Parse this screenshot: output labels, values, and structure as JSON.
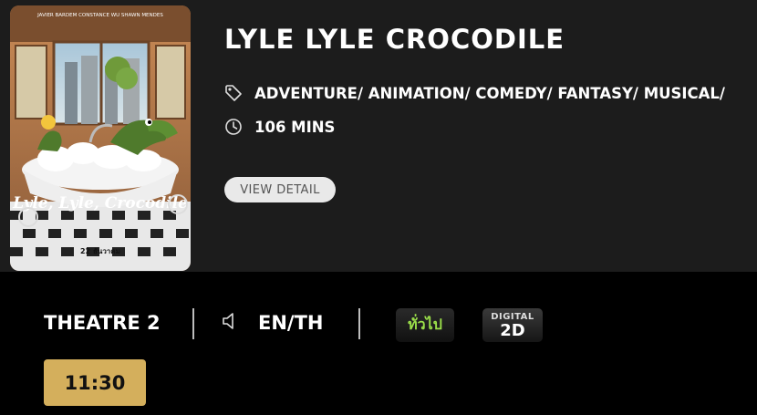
{
  "movie": {
    "title": "LYLE LYLE CROCODILE",
    "genres": "ADVENTURE/ ANIMATION/ COMEDY/ FANTASY/ MUSICAL/",
    "duration": "106 MINS",
    "view_detail_label": "VIEW DETAIL",
    "poster": {
      "cast_line": "JAVIER BARDEM   CONSTANCE WU   SHAWN MENDES",
      "title": "Lyle, Lyle, Crocodile",
      "date": "22 ธันวาคม"
    }
  },
  "session": {
    "theatre": "THEATRE 2",
    "audio_icon": "speaker-icon",
    "language": "EN/TH",
    "rating_badge": "ทั่วไป",
    "format_badge": {
      "line1": "DIGITAL",
      "line2": "2D"
    },
    "showtimes": [
      "11:30"
    ]
  },
  "colors": {
    "background": "#000000",
    "card": "#1c1c1c",
    "showtime_button": "#d4af5c",
    "view_detail_button": "#e9e9e9",
    "rating_text": "#9be04a"
  }
}
